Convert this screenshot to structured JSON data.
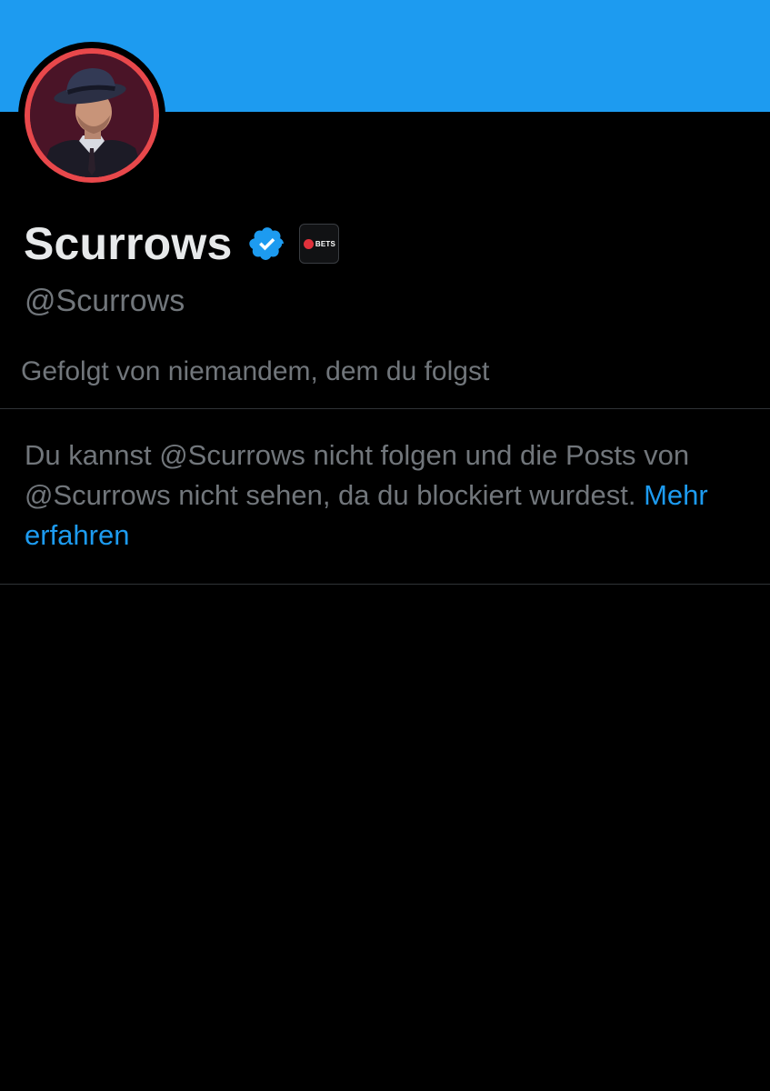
{
  "profile": {
    "display_name": "Scurrows",
    "handle": "@Scurrows",
    "followed_by": "Gefolgt von niemandem, dem du folgst",
    "verified_icon": "verified-badge-icon",
    "affiliate_badge": {
      "icon": "bets-affiliate-icon",
      "label": "BETS"
    },
    "avatar_icon": "avatar-man-in-fedora"
  },
  "blocked": {
    "message": "Du kannst @Scurrows nicht folgen und die Posts von @Scurrows nicht sehen, da du blockiert wurdest.",
    "learn_more": "Mehr erfahren"
  },
  "colors": {
    "banner": "#1d9bf0",
    "background": "#000000",
    "primary_text": "#e7e9ea",
    "secondary_text": "#71767b",
    "link": "#1d9bf0",
    "avatar_ring": "#e8484b",
    "divider": "#2f3336"
  }
}
